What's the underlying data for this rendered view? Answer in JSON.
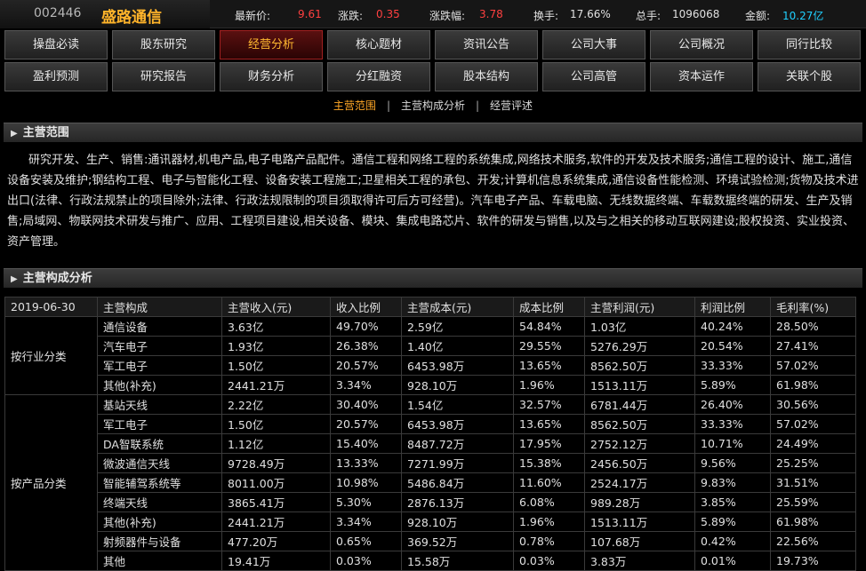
{
  "stock": {
    "code": "002446",
    "name": "盛路通信"
  },
  "quote": [
    {
      "label": "最新价:",
      "value": "9.61",
      "color": "red"
    },
    {
      "label": "涨跌:",
      "value": "0.35",
      "color": "red"
    },
    {
      "label": "涨跌幅:",
      "value": "3.78",
      "color": "red"
    },
    {
      "label": "换手:",
      "value": "17.66%",
      "color": "gray"
    },
    {
      "label": "总手:",
      "value": "1096068",
      "color": "gray"
    },
    {
      "label": "金额:",
      "value": "10.27亿",
      "color": "cyan"
    }
  ],
  "nav_row1": [
    "操盘必读",
    "股东研究",
    "经营分析",
    "核心题材",
    "资讯公告",
    "公司大事",
    "公司概况",
    "同行比较"
  ],
  "nav_row2": [
    "盈利预测",
    "研究报告",
    "财务分析",
    "分红融资",
    "股本结构",
    "公司高管",
    "资本运作",
    "关联个股"
  ],
  "active_tab": "经营分析",
  "subnav": [
    "主营范围",
    "主营构成分析",
    "经营评述"
  ],
  "sub_sep": "|",
  "sec1_title": "主营范围",
  "scope_text": "研究开发、生产、销售:通讯器材,机电产品,电子电路产品配件。通信工程和网络工程的系统集成,网络技术服务,软件的开发及技术服务;通信工程的设计、施工,通信设备安装及维护;钢结构工程、电子与智能化工程、设备安装工程施工;卫星相关工程的承包、开发;计算机信息系统集成,通信设备性能检测、环境试验检测;货物及技术进出口(法律、行政法规禁止的项目除外;法律、行政法规限制的项目须取得许可后方可经营)。汽车电子产品、车载电脑、无线数据终端、车载数据终端的研发、生产及销售;局域网、物联网技术研发与推广、应用、工程项目建设,相关设备、模块、集成电路芯片、软件的研发与销售,以及与之相关的移动互联网建设;股权投资、实业投资、资产管理。",
  "sec2_title": "主营构成分析",
  "table": {
    "date": "2019-06-30",
    "headers": [
      "主营构成",
      "主营收入(元)",
      "收入比例",
      "主营成本(元)",
      "成本比例",
      "主营利润(元)",
      "利润比例",
      "毛利率(%)"
    ],
    "groups": [
      {
        "name": "按行业分类",
        "rows": [
          [
            "通信设备",
            "3.63亿",
            "49.70%",
            "2.59亿",
            "54.84%",
            "1.03亿",
            "40.24%",
            "28.50%"
          ],
          [
            "汽车电子",
            "1.93亿",
            "26.38%",
            "1.40亿",
            "29.55%",
            "5276.29万",
            "20.54%",
            "27.41%"
          ],
          [
            "军工电子",
            "1.50亿",
            "20.57%",
            "6453.98万",
            "13.65%",
            "8562.50万",
            "33.33%",
            "57.02%"
          ],
          [
            "其他(补充)",
            "2441.21万",
            "3.34%",
            "928.10万",
            "1.96%",
            "1513.11万",
            "5.89%",
            "61.98%"
          ]
        ]
      },
      {
        "name": "按产品分类",
        "rows": [
          [
            "基站天线",
            "2.22亿",
            "30.40%",
            "1.54亿",
            "32.57%",
            "6781.44万",
            "26.40%",
            "30.56%"
          ],
          [
            "军工电子",
            "1.50亿",
            "20.57%",
            "6453.98万",
            "13.65%",
            "8562.50万",
            "33.33%",
            "57.02%"
          ],
          [
            "DA智联系统",
            "1.12亿",
            "15.40%",
            "8487.72万",
            "17.95%",
            "2752.12万",
            "10.71%",
            "24.49%"
          ],
          [
            "微波通信天线",
            "9728.49万",
            "13.33%",
            "7271.99万",
            "15.38%",
            "2456.50万",
            "9.56%",
            "25.25%"
          ],
          [
            "智能辅驾系统等",
            "8011.00万",
            "10.98%",
            "5486.84万",
            "11.60%",
            "2524.17万",
            "9.83%",
            "31.51%"
          ],
          [
            "终端天线",
            "3865.41万",
            "5.30%",
            "2876.13万",
            "6.08%",
            "989.28万",
            "3.85%",
            "25.59%"
          ],
          [
            "其他(补充)",
            "2441.21万",
            "3.34%",
            "928.10万",
            "1.96%",
            "1513.11万",
            "5.89%",
            "61.98%"
          ],
          [
            "射频器件与设备",
            "477.20万",
            "0.65%",
            "369.52万",
            "0.78%",
            "107.68万",
            "0.42%",
            "22.56%"
          ],
          [
            "其他",
            "19.41万",
            "0.03%",
            "15.58万",
            "0.03%",
            "3.83万",
            "0.01%",
            "19.73%"
          ]
        ]
      }
    ]
  }
}
